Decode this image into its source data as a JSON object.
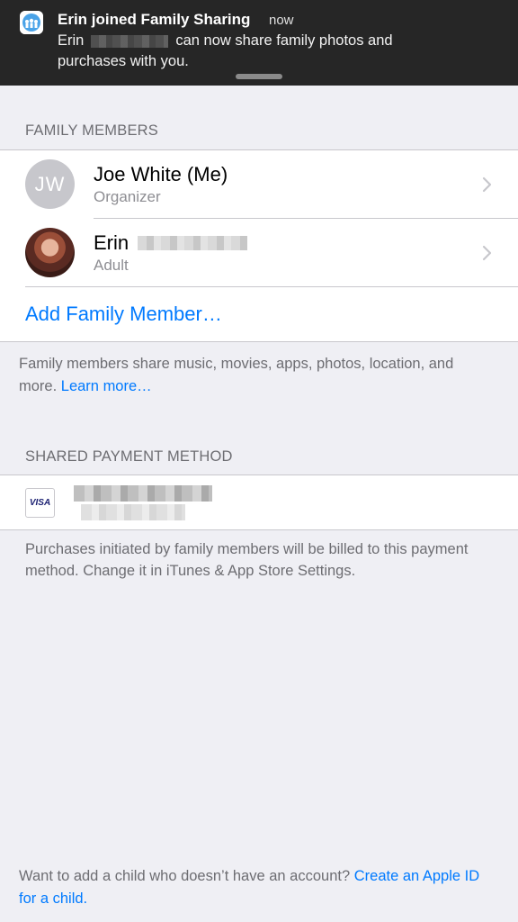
{
  "notification": {
    "title": "Erin joined Family Sharing",
    "time": "now",
    "body_prefix": "Erin",
    "body_suffix": "can now share family photos and",
    "body_line2": "purchases with you."
  },
  "family_members": {
    "header": "FAMILY MEMBERS",
    "members": [
      {
        "initials": "JW",
        "name": "Joe White (Me)",
        "role": "Organizer"
      },
      {
        "name": "Erin",
        "role": "Adult"
      }
    ],
    "add_label": "Add Family Member…",
    "footnote_text": "Family members share music, movies, apps, photos, location, and more.",
    "footnote_link": "Learn more…"
  },
  "payment": {
    "header": "SHARED PAYMENT METHOD",
    "card_brand": "VISA",
    "footnote": "Purchases initiated by family members will be billed to this payment method. Change it in iTunes & App Store Settings."
  },
  "bottom_note": {
    "text": "Want to add a child who doesn’t have an account?",
    "link": "Create an Apple ID for a child."
  },
  "colors": {
    "accent": "#007aff",
    "background": "#efeff4",
    "banner": "#262626"
  }
}
